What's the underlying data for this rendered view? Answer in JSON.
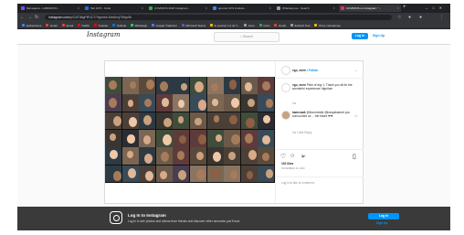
{
  "browser": {
    "tabs": [
      {
        "label": "Mensajeria - LABORATO...",
        "color": "#7c4dff",
        "active": false
      },
      {
        "label": "Tab 1970 - Outlo",
        "color": "#1a73e8",
        "active": false
      },
      {
        "label": "COVIDIOS 2020 Instagram...",
        "color": "#34a853",
        "active": false
      },
      {
        "label": "aprovar 10% Instituto...",
        "color": "#4285f4",
        "active": false
      },
      {
        "label": "Whatsapp.es - Search",
        "color": "#9aa0a6",
        "active": false
      },
      {
        "label": "COVIDIOS on Instagram: \"...",
        "color": "#e1306c",
        "active": true
      }
    ],
    "url_host": "instagram.com",
    "url_path": "/p/CAT36gPlR1C7/?igshid=1bb4nvj7i0wp0b",
    "bookmarks": [
      "Aplicaciones",
      "Gmail",
      "Gmail",
      "Netflix",
      "Youtube",
      "Outlook",
      "Whatsapp",
      "Google Traductor",
      "Microsoft Teams",
      "IL Lexicon 1.0 de Y...",
      "Amor",
      "Inicio",
      "Gmail",
      "Subscrit Test",
      "Otros marcadores"
    ]
  },
  "instagram": {
    "logo": "Instagram",
    "search_placeholder": "Search",
    "login_label": "Log In",
    "signup_label": "Sign Up",
    "post": {
      "username": "vgu_mem",
      "follow_label": "Follow",
      "menu": "...",
      "caption_user": "vgu_mem",
      "caption_text": "Pitch of day 1. Thank you all for the wonderful experience! #ignitum",
      "caption_time": "1w",
      "comment_user": "kamruzak",
      "comment_text": "@iforumesite @iranyakamrnt you surrounded us ... the future ❤❤",
      "comment_meta": "1w   1 like   Reply",
      "likes": "102 likes",
      "date": "NOVEMBER 19, 2020",
      "login_prompt": "Log in to like or comment."
    },
    "banner": {
      "title": "Log In to Instagram",
      "subtitle": "Log in to see photos and videos from friends and discover other accounts you'll love.",
      "login_label": "Log In",
      "signup_label": "Sign Up"
    }
  },
  "colors": {
    "accent": "#0095f6",
    "chrome_dark": "#202124",
    "chrome_bar": "#35363a",
    "banner": "#3a3a3a"
  }
}
